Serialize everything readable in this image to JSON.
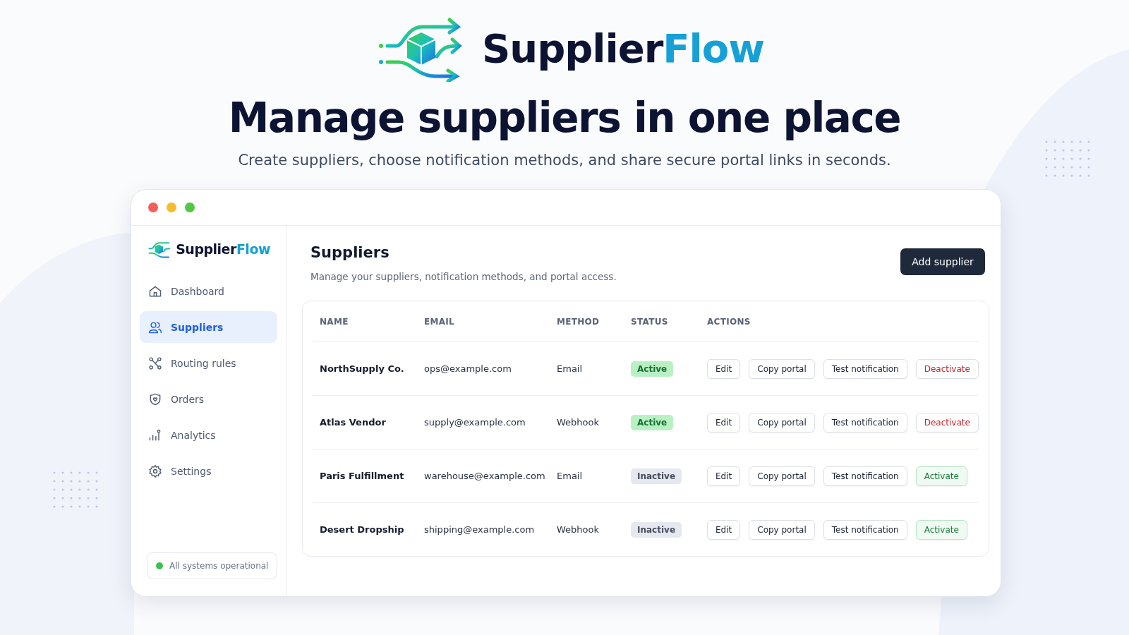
{
  "hero": {
    "brand": {
      "name": "Supplier",
      "accent": "Flow"
    },
    "headline": "Manage suppliers in one place",
    "subtitle": "Create suppliers, choose notification methods, and share secure portal links in seconds."
  },
  "sidebar": {
    "brand": {
      "name": "Supplier",
      "accent": "Flow"
    },
    "items": [
      {
        "label": "Dashboard",
        "selected": false
      },
      {
        "label": "Suppliers",
        "selected": true
      },
      {
        "label": "Routing rules",
        "selected": false
      },
      {
        "label": "Orders",
        "selected": false
      },
      {
        "label": "Analytics",
        "selected": false
      },
      {
        "label": "Settings",
        "selected": false
      }
    ],
    "status": {
      "label": "All systems operational",
      "color": "#3fbf4f"
    }
  },
  "page": {
    "title": "Suppliers",
    "description": "Manage your suppliers, notification methods, and portal access.",
    "primary_button": "Add supplier"
  },
  "table": {
    "columns": [
      "NAME",
      "EMAIL",
      "METHOD",
      "STATUS",
      "ACTIONS"
    ],
    "rows": [
      {
        "name": "NorthSupply Co.",
        "email": "ops@example.com",
        "method": "Email",
        "status": "Active",
        "active": true,
        "actions": [
          {
            "label": "Edit",
            "kind": "default"
          },
          {
            "label": "Copy portal",
            "kind": "default"
          },
          {
            "label": "Test notification",
            "kind": "default"
          },
          {
            "label": "Deactivate",
            "kind": "danger"
          }
        ]
      },
      {
        "name": "Atlas Vendor",
        "email": "supply@example.com",
        "method": "Webhook",
        "status": "Active",
        "active": true,
        "actions": [
          {
            "label": "Edit",
            "kind": "default"
          },
          {
            "label": "Copy portal",
            "kind": "default"
          },
          {
            "label": "Test notification",
            "kind": "default"
          },
          {
            "label": "Deactivate",
            "kind": "danger"
          }
        ]
      },
      {
        "name": "Paris Fulfillment",
        "email": "warehouse@example.com",
        "method": "Email",
        "status": "Inactive",
        "active": false,
        "actions": [
          {
            "label": "Edit",
            "kind": "default"
          },
          {
            "label": "Copy portal",
            "kind": "default"
          },
          {
            "label": "Test notification",
            "kind": "default"
          },
          {
            "label": "Activate",
            "kind": "success"
          }
        ]
      },
      {
        "name": "Desert Dropship",
        "email": "shipping@example.com",
        "method": "Webhook",
        "status": "Inactive",
        "active": false,
        "actions": [
          {
            "label": "Edit",
            "kind": "default"
          },
          {
            "label": "Copy portal",
            "kind": "default"
          },
          {
            "label": "Test notification",
            "kind": "default"
          },
          {
            "label": "Activate",
            "kind": "success"
          }
        ]
      }
    ]
  }
}
